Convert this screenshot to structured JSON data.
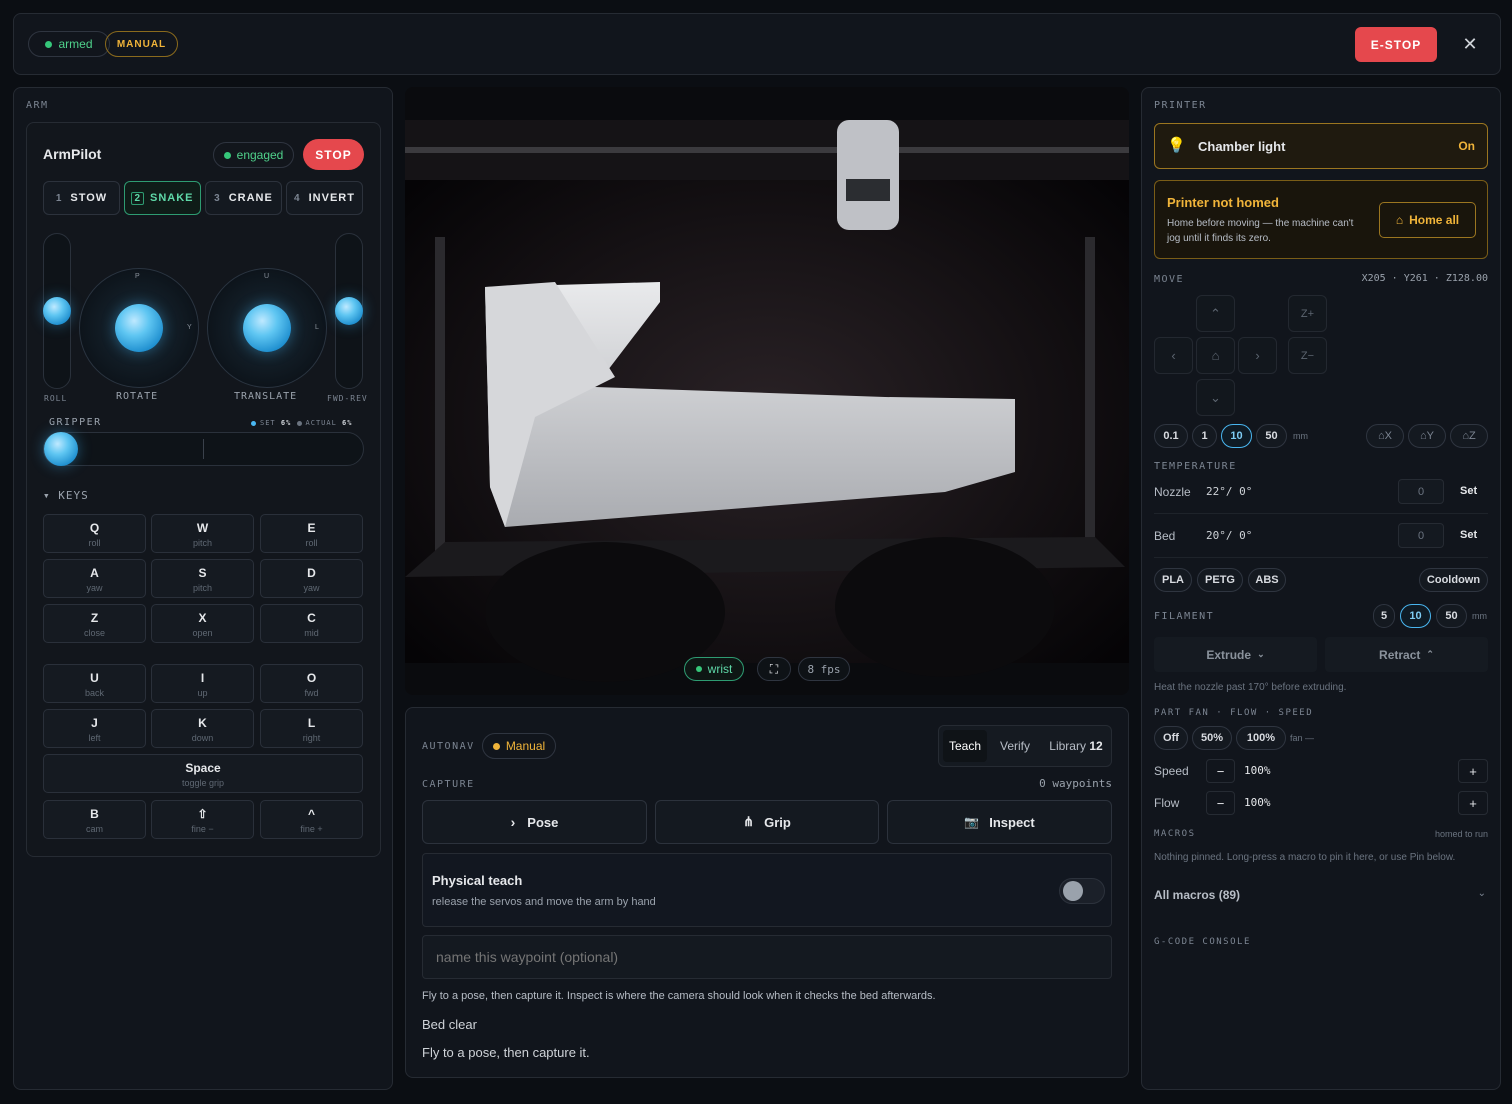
{
  "topbar": {
    "status_armed": "armed",
    "mode": "MANUAL",
    "estop": "E-STOP",
    "close_icon": "close-icon"
  },
  "arm": {
    "section": "ARM",
    "title": "ArmPilot",
    "engaged": "engaged",
    "stop": "STOP",
    "modes": [
      {
        "num": "1",
        "label": "STOW"
      },
      {
        "num": "2",
        "label": "SNAKE"
      },
      {
        "num": "3",
        "label": "CRANE"
      },
      {
        "num": "4",
        "label": "INVERT"
      }
    ],
    "roll": "ROLL",
    "rotate": "ROTATE",
    "translate": "TRANSLATE",
    "fwdrev": "FWD-REV",
    "rotate_marks": {
      "top": "P",
      "right": "Y"
    },
    "translate_marks": {
      "top": "U",
      "right": "L"
    },
    "gripper": "GRIPPER",
    "gripper_set": "SET",
    "gripper_set_val": "6%",
    "gripper_actual": "ACTUAL",
    "gripper_actual_val": "6%",
    "keys_title": "▾ KEYS",
    "keys": [
      {
        "k": "Q",
        "s": "roll"
      },
      {
        "k": "W",
        "s": "pitch"
      },
      {
        "k": "E",
        "s": "roll"
      },
      {
        "k": "A",
        "s": "yaw"
      },
      {
        "k": "S",
        "s": "pitch"
      },
      {
        "k": "D",
        "s": "yaw"
      },
      {
        "k": "Z",
        "s": "close"
      },
      {
        "k": "X",
        "s": "open"
      },
      {
        "k": "C",
        "s": "mid"
      },
      {
        "k": "U",
        "s": "back"
      },
      {
        "k": "I",
        "s": "up"
      },
      {
        "k": "O",
        "s": "fwd"
      },
      {
        "k": "J",
        "s": "left"
      },
      {
        "k": "K",
        "s": "down"
      },
      {
        "k": "L",
        "s": "right"
      },
      {
        "k": "Space",
        "s": "toggle grip"
      },
      {
        "k": "B",
        "s": "cam"
      },
      {
        "k": "⇧",
        "s": "fine −"
      },
      {
        "k": "^",
        "s": "fine +"
      }
    ]
  },
  "camera": {
    "source": "wrist",
    "fps": "8 fps"
  },
  "autonav": {
    "section": "AUTONAV",
    "mode": "Manual",
    "tabs": {
      "teach": "Teach",
      "verify": "Verify",
      "library": "Library",
      "library_count": "12"
    },
    "capture": "CAPTURE",
    "waypoints": "0 waypoints",
    "pose": "Pose",
    "grip": "Grip",
    "inspect": "Inspect",
    "physical_title": "Physical teach",
    "physical_sub": "release the servos and move the arm by hand",
    "name_placeholder": "name this waypoint (optional)",
    "hint": "Fly to a pose, then capture it. Inspect is where the camera should look when it checks the bed afterwards.",
    "status": "Bed clear",
    "hint2": "Fly to a pose, then capture it."
  },
  "printer": {
    "section": "PRINTER",
    "light_label": "Chamber light",
    "light_state": "On",
    "warn_title": "Printer not homed",
    "warn_text": "Home before moving — the machine can't jog until it finds its zero.",
    "home_all": "Home all",
    "move": "MOVE",
    "position": "X205 · Y261 · Z128.00",
    "jog": {
      "zplus": "Z+",
      "zminus": "Z−"
    },
    "steps": [
      "0.1",
      "1",
      "10",
      "50"
    ],
    "steps_unit": "mm",
    "home_axes": [
      "⌂X",
      "⌂Y",
      "⌂Z"
    ],
    "temperature": "TEMPERATURE",
    "nozzle_label": "Nozzle",
    "nozzle_val": "22°/ 0°",
    "nozzle_input": "0",
    "bed_label": "Bed",
    "bed_val": "20°/ 0°",
    "bed_input": "0",
    "set": "Set",
    "presets": [
      "PLA",
      "PETG",
      "ABS"
    ],
    "cooldown": "Cooldown",
    "filament": "FILAMENT",
    "fil_steps": [
      "5",
      "10",
      "50"
    ],
    "fil_unit": "mm",
    "extrude": "Extrude",
    "retract": "Retract",
    "heat_hint": "Heat the nozzle past 170° before extruding.",
    "fan_label": "PART FAN · FLOW · SPEED",
    "fan_opts": [
      "Off",
      "50%",
      "100%"
    ],
    "fan_state": "fan —",
    "speed_label": "Speed",
    "speed_val": "100%",
    "flow_label": "Flow",
    "flow_val": "100%",
    "macros": "MACROS",
    "macros_note": "homed to run",
    "macros_hint": "Nothing pinned. Long-press a macro to pin it here, or use Pin below.",
    "all_macros": "All macros (89)",
    "gcode": "G-CODE CONSOLE"
  }
}
